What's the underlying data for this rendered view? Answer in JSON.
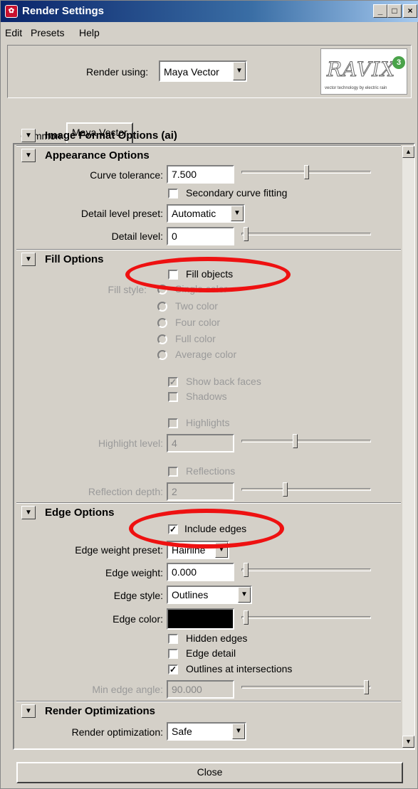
{
  "window": {
    "title": "Render Settings",
    "min": "_",
    "max": "□",
    "close": "×"
  },
  "menu": [
    "Edit",
    "Presets",
    "Help"
  ],
  "render_using": {
    "label": "Render using:",
    "value": "Maya Vector"
  },
  "logo": {
    "text": "RAVIX",
    "badge": "3",
    "tagline": "vector technology by electric rain"
  },
  "tabs": [
    "Common",
    "Maya Vector"
  ],
  "image_format": {
    "title": "Image Format Options (ai)"
  },
  "appearance": {
    "title": "Appearance Options",
    "curve_tolerance_label": "Curve tolerance:",
    "curve_tolerance": "7.500",
    "secondary_fitting": "Secondary curve fitting",
    "detail_preset_label": "Detail level preset:",
    "detail_preset": "Automatic",
    "detail_level_label": "Detail level:",
    "detail_level": "0"
  },
  "fill": {
    "title": "Fill Options",
    "fill_objects": "Fill objects",
    "fill_style_label": "Fill style:",
    "styles": [
      "Single color",
      "Two color",
      "Four color",
      "Full color",
      "Average color"
    ],
    "show_back_faces": "Show back faces",
    "shadows": "Shadows",
    "highlights": "Highlights",
    "highlight_level_label": "Highlight level:",
    "highlight_level": "4",
    "reflections": "Reflections",
    "reflection_depth_label": "Reflection depth:",
    "reflection_depth": "2"
  },
  "edge": {
    "title": "Edge Options",
    "include_edges": "Include edges",
    "weight_preset_label": "Edge weight preset:",
    "weight_preset": "Hairline",
    "weight_label": "Edge weight:",
    "weight": "0.000",
    "style_label": "Edge style:",
    "style": "Outlines",
    "color_label": "Edge color:",
    "hidden_edges": "Hidden edges",
    "edge_detail": "Edge detail",
    "outlines_intersections": "Outlines at intersections",
    "min_angle_label": "Min edge angle:",
    "min_angle": "90.000"
  },
  "optim": {
    "title": "Render Optimizations",
    "label": "Render optimization:",
    "value": "Safe"
  },
  "close_label": "Close",
  "colors": {
    "title_bar": "#0a246a",
    "highlight_oval": "#e11111",
    "dialog_bg": "#d4d0c8",
    "edge_color": "#000000"
  }
}
